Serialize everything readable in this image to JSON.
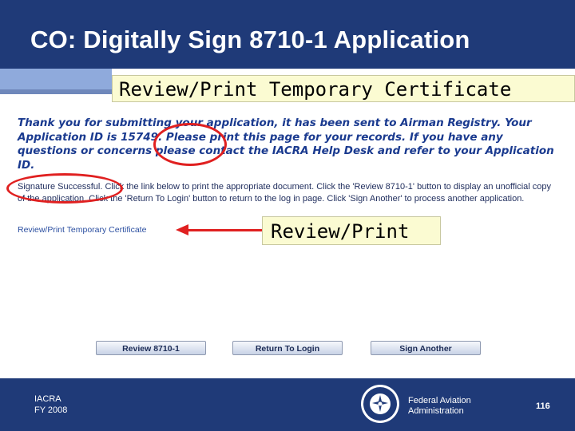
{
  "slide": {
    "title": "CO: Digitally Sign 8710-1 Application",
    "subtitle_callout": "Review/Print Temporary Certificate",
    "review_callout": "Review/Print"
  },
  "page": {
    "thanks_message": "Thank you for submitting your application, it has been sent to Airman Registry. Your Application ID is 15749. Please print this page for your records. If you have any questions or concerns please contact the IACRA Help Desk and refer to your Application ID.",
    "signature_info": "Signature Successful. Click the link below to print the appropriate document. Click the 'Review 8710-1' button to display an unofficial copy of the application. Click the 'Return To Login' button to return to the log in page. Click 'Sign Another' to process another application.",
    "temp_cert_link": "Review/Print Temporary Certificate",
    "buttons": {
      "review": "Review 8710-1",
      "return_login": "Return To Login",
      "sign_another": "Sign Another"
    }
  },
  "footer": {
    "program": "IACRA",
    "year": "FY 2008",
    "agency_line1": "Federal Aviation",
    "agency_line2": "Administration",
    "page_number": "116"
  },
  "colors": {
    "header_blue": "#1f3a78",
    "accent_light_blue": "#8faadc",
    "callout_yellow": "#fbfbd2",
    "message_blue": "#1a3a8f",
    "highlight_red": "#e02020"
  },
  "icons": {
    "seal": "faa-seal-icon"
  }
}
